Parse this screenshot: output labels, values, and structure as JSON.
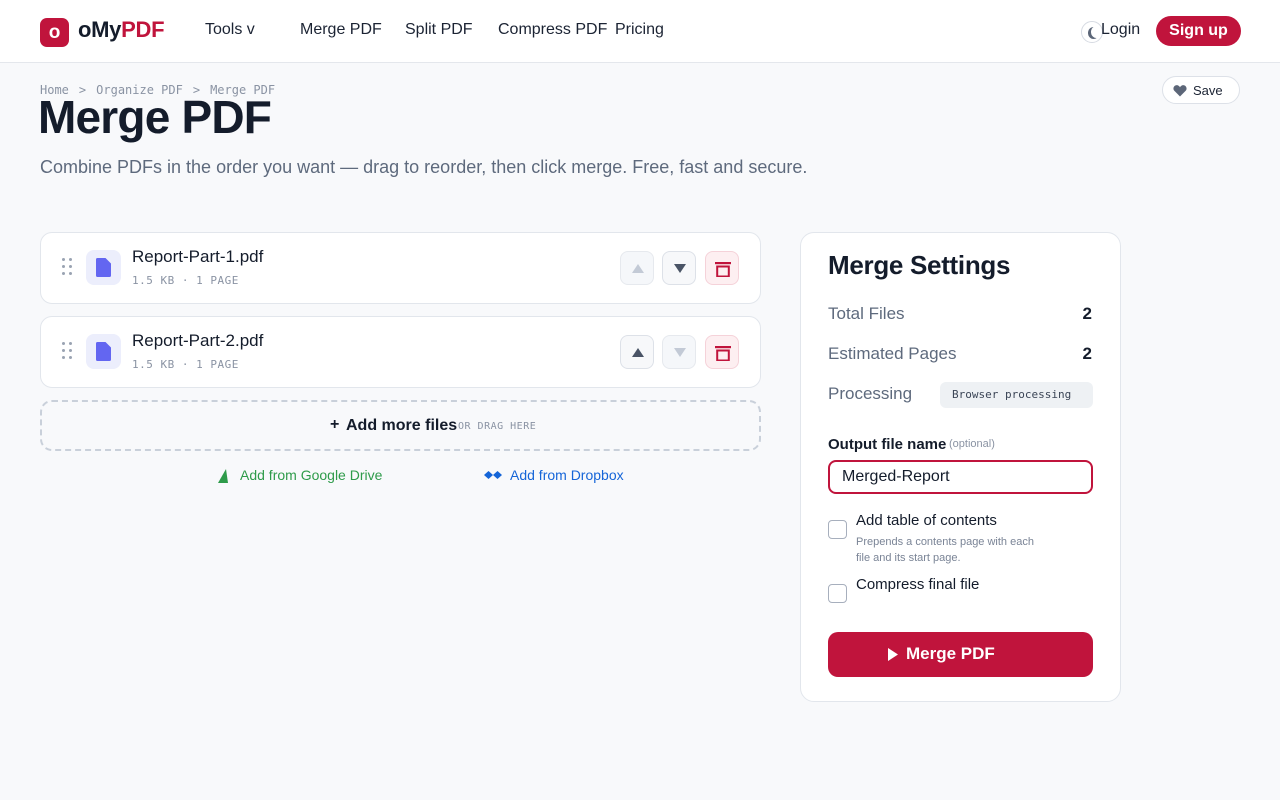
{
  "header": {
    "logo_letter": "o",
    "brand_part1": "oMy",
    "brand_part2": "PDF",
    "nav": {
      "tools": "Tools  v",
      "merge": "Merge PDF",
      "split": "Split PDF",
      "compress": "Compress PDF",
      "pricing": "Pricing"
    },
    "login": "Login",
    "signup": "Sign up"
  },
  "breadcrumb": {
    "home": "Home",
    "organize": "Organize PDF",
    "current": "Merge PDF",
    "separator": ">"
  },
  "save_label": "Save",
  "page": {
    "title": "Merge PDF",
    "subtitle": "Combine PDFs in the order you want — drag to reorder, then click merge. Free, fast and secure."
  },
  "files": [
    {
      "name": "Report-Part-1.pdf",
      "meta": "1.5 KB · 1 PAGE",
      "can_move_up": false,
      "can_move_down": true
    },
    {
      "name": "Report-Part-2.pdf",
      "meta": "1.5 KB · 1 PAGE",
      "can_move_up": true,
      "can_move_down": false
    }
  ],
  "add_more": {
    "plus": "+",
    "label": "Add more files",
    "hint": "OR DRAG HERE"
  },
  "cloud": {
    "google": "Add from Google Drive",
    "dropbox": "Add from Dropbox"
  },
  "settings": {
    "title": "Merge Settings",
    "total_files_label": "Total Files",
    "total_files_value": "2",
    "estimated_pages_label": "Estimated Pages",
    "estimated_pages_value": "2",
    "processing_label": "Processing",
    "processing_value": "Browser processing",
    "output_label": "Output file name",
    "output_optional": "(optional)",
    "output_value": "Merged-Report",
    "toc_label": "Add table of contents",
    "toc_help": "Prepends a contents page with each file and its start page.",
    "toc_checked": false,
    "compress_label": "Compress final file",
    "compress_checked": false,
    "merge_button": "Merge PDF"
  },
  "colors": {
    "brand": "#c0143c",
    "google_drive": "#2e9b4a",
    "dropbox": "#1565d8",
    "file_icon": "#6366f1"
  },
  "icons": {
    "theme_toggle": "moon-icon",
    "save": "heart-icon",
    "drag": "drag-handle-icon",
    "file": "file-icon",
    "up": "arrow-up-icon",
    "down": "arrow-down-icon",
    "delete": "trash-icon",
    "google": "google-drive-icon",
    "dropbox": "dropbox-icon",
    "merge": "play-icon"
  }
}
